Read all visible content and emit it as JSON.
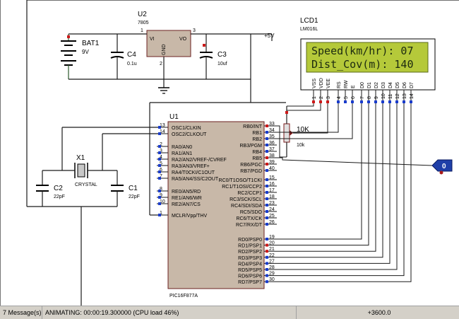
{
  "schematic": {
    "battery": {
      "ref": "BAT1",
      "value": "9V"
    },
    "regulator": {
      "ref": "U2",
      "value": "7805",
      "pin_vi": "VI",
      "pin_vo": "VO",
      "pin_gnd": "GND",
      "pin1": "1",
      "pin2": "2",
      "pin3": "3"
    },
    "c4": {
      "ref": "C4",
      "value": "0.1u"
    },
    "c3": {
      "ref": "C3",
      "value": "10uf"
    },
    "supply_label": "+5V",
    "lcd": {
      "ref": "LCD1",
      "model": "LM016L",
      "line1": "Speed(km/hr): 07",
      "line2": "Dist_Cov(m): 140",
      "pins": [
        "VSS",
        "VDD",
        "VEE",
        "RS",
        "RW",
        "E",
        "D0",
        "D1",
        "D2",
        "D3",
        "D4",
        "D5",
        "D6",
        "D7"
      ],
      "pin_numbers": [
        "1",
        "2",
        "3",
        "4",
        "5",
        "6",
        "7",
        "8",
        "9",
        "10",
        "11",
        "12",
        "13",
        "14"
      ]
    },
    "pot": {
      "ref": "10K",
      "value": "10k"
    },
    "crystal": {
      "ref": "X1",
      "value": "CRYSTAL"
    },
    "c2": {
      "ref": "C2",
      "value": "22pF"
    },
    "c1": {
      "ref": "C1",
      "value": "22pF"
    },
    "mcu": {
      "ref": "U1",
      "part": "PIC16F877A",
      "left_pins": [
        {
          "num": "13",
          "name": "OSC1/CLKIN"
        },
        {
          "num": "14",
          "name": "OSC2/CLKOUT"
        },
        {
          "num": "2",
          "name": "RA0/AN0"
        },
        {
          "num": "3",
          "name": "RA1/AN1"
        },
        {
          "num": "4",
          "name": "RA2/AN2/VREF-/CVREF"
        },
        {
          "num": "5",
          "name": "RA3/AN3/VREF+"
        },
        {
          "num": "6",
          "name": "RA4/T0CKI/C1OUT"
        },
        {
          "num": "7",
          "name": "RA5/AN4/SS/C2OUT"
        },
        {
          "num": "8",
          "name": "RE0/AN5/RD"
        },
        {
          "num": "9",
          "name": "RE1/AN6/WR"
        },
        {
          "num": "10",
          "name": "RE2/AN7/CS"
        },
        {
          "num": "1",
          "name": "MCLR/Vpp/THV"
        }
      ],
      "right_pins": [
        {
          "num": "33",
          "name": "RB0/INT"
        },
        {
          "num": "34",
          "name": "RB1"
        },
        {
          "num": "35",
          "name": "RB2"
        },
        {
          "num": "36",
          "name": "RB3/PGM"
        },
        {
          "num": "37",
          "name": "RB4"
        },
        {
          "num": "38",
          "name": "RB5"
        },
        {
          "num": "39",
          "name": "RB6/PGC"
        },
        {
          "num": "40",
          "name": "RB7/PGD"
        },
        {
          "num": "15",
          "name": "RC0/T1OSO/T1CKI"
        },
        {
          "num": "16",
          "name": "RC1/T1OSI/CCP2"
        },
        {
          "num": "17",
          "name": "RC2/CCP1"
        },
        {
          "num": "18",
          "name": "RC3/SCK/SCL"
        },
        {
          "num": "23",
          "name": "RC4/SDI/SDA"
        },
        {
          "num": "24",
          "name": "RC5/SDO"
        },
        {
          "num": "25",
          "name": "RC6/TX/CK"
        },
        {
          "num": "26",
          "name": "RC7/RX/DT"
        },
        {
          "num": "19",
          "name": "RD0/PSP0"
        },
        {
          "num": "20",
          "name": "RD1/PSP1"
        },
        {
          "num": "21",
          "name": "RD2/PSP2"
        },
        {
          "num": "22",
          "name": "RD3/PSP3"
        },
        {
          "num": "27",
          "name": "RD4/PSP4"
        },
        {
          "num": "28",
          "name": "RD5/PSP5"
        },
        {
          "num": "29",
          "name": "RD6/PSP6"
        },
        {
          "num": "30",
          "name": "RD7/PSP7"
        }
      ]
    },
    "logic_probe": {
      "value": "0"
    }
  },
  "colors": {
    "lcd_bg": "#b5c93a",
    "chip_fill": "#c8b8a8",
    "pin_blue": "#1a3ccc",
    "pin_red": "#cc1a1a",
    "probe_blue": "#1f3fa8"
  },
  "statusbar": {
    "messages": "7 Message(s)",
    "animating": "ANIMATING: 00:00:19.300000 (CPU load 46%)",
    "coordinate": "+3600.0"
  }
}
